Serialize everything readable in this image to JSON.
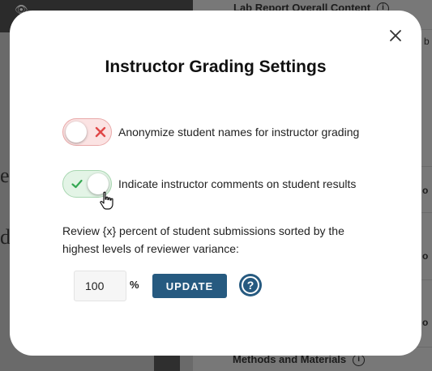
{
  "background": {
    "section_top": "Lab Report Overall Content",
    "section_bottom": "Methods and Materials",
    "fragment_e": "e",
    "fragment_d": "d",
    "fragment_b": "b",
    "fragment_o": "o"
  },
  "modal": {
    "title": "Instructor Grading Settings",
    "close_icon": "close-icon",
    "toggles": [
      {
        "label": "Anonymize student names for instructor grading",
        "state": "off"
      },
      {
        "label": "Indicate instructor comments on student results",
        "state": "on"
      }
    ],
    "review_text": "Review {x} percent of student submissions sorted by the highest levels of reviewer variance:",
    "percent_value": "100",
    "percent_sign": "%",
    "update_label": "UPDATE",
    "help_glyph": "?",
    "colors": {
      "primary": "#265a80",
      "toggle_off_bg": "#fbe3e3",
      "toggle_off_icon": "#e04848",
      "toggle_on_bg": "#e3f4e6",
      "toggle_on_icon": "#35a853"
    }
  }
}
